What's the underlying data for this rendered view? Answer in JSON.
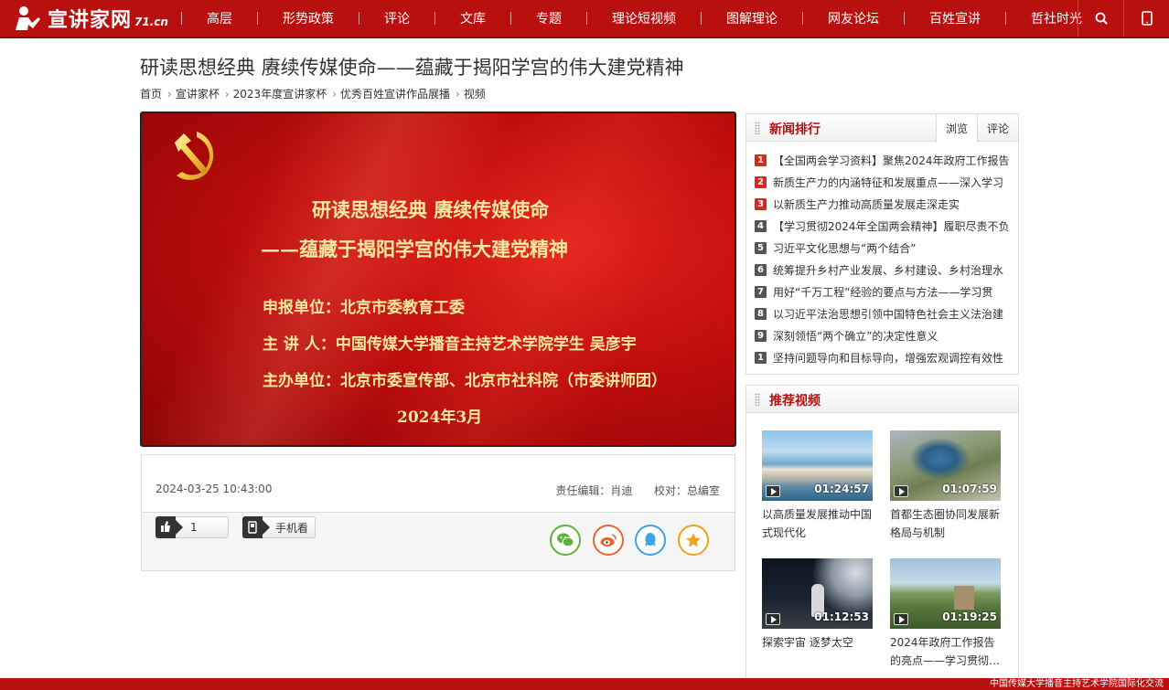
{
  "site": {
    "logo_text": "宣讲家网",
    "logo_sub": "71.cn"
  },
  "nav": {
    "items": [
      "高层",
      "形势政策",
      "评论",
      "文库",
      "专题",
      "理论短视频",
      "图解理论",
      "网友论坛",
      "百姓宣讲",
      "哲社时光"
    ],
    "icons": [
      "search-icon",
      "mobile-icon"
    ]
  },
  "article": {
    "title": "研读思想经典 赓续传媒使命——蕴藏于揭阳学宫的伟大建党精神",
    "breadcrumb": [
      "首页",
      "宣讲家杯",
      "2023年度宣讲家杯",
      "优秀百姓宣讲作品展播",
      "视频"
    ]
  },
  "video": {
    "title_line1": "研读思想经典 赓续传媒使命",
    "title_line2": "——蕴藏于揭阳学宫的伟大建党精神",
    "info": [
      "申报单位：北京市委教育工委",
      "主 讲  人：中国传媒大学播音主持艺术学院学生  吴彦宇",
      "主办单位：北京市委宣传部、北京市社科院（市委讲师团）"
    ],
    "date": "2024年3月"
  },
  "meta": {
    "datetime": "2024-03-25 10:43:00",
    "editor": "责任编辑：肖迪",
    "proof": "校对：总编室",
    "like_count": "1",
    "mobile_label": "手机看",
    "share_icons": [
      "wechat-icon",
      "weibo-icon",
      "qq-icon",
      "favorite-icon"
    ]
  },
  "ranking": {
    "title": "新闻排行",
    "tabs": [
      "浏览",
      "评论"
    ],
    "items": [
      {
        "num": "1",
        "text": "【全国两会学习资料】聚焦2024年政府工作报告"
      },
      {
        "num": "2",
        "text": "新质生产力的内涵特征和发展重点——深入学习"
      },
      {
        "num": "3",
        "text": "以新质生产力推动高质量发展走深走实"
      },
      {
        "num": "4",
        "text": "【学习贯彻2024年全国两会精神】履职尽责不负"
      },
      {
        "num": "5",
        "text": "习近平文化思想与“两个结合”"
      },
      {
        "num": "6",
        "text": "统筹提升乡村产业发展、乡村建设、乡村治理水"
      },
      {
        "num": "7",
        "text": "用好“千万工程”经验的要点与方法——学习贯"
      },
      {
        "num": "8",
        "text": "以习近平法治思想引领中国特色社会主义法治建"
      },
      {
        "num": "9",
        "text": "深刻领悟“两个确立”的决定性意义"
      },
      {
        "num": "1",
        "text": "坚持问题导向和目标导向，增强宏观调控有效性"
      }
    ]
  },
  "recommend": {
    "title": "推荐视频",
    "items": [
      {
        "duration": "01:24:57",
        "title": "以高质量发展推动中国式现代化"
      },
      {
        "duration": "01:07:59",
        "title": "首都生态圈协同发展新格局与机制"
      },
      {
        "duration": "01:12:53",
        "title": "探索宇宙 逐梦太空"
      },
      {
        "duration": "01:19:25",
        "title": "2024年政府工作报告的亮点——学习贯彻…"
      }
    ]
  },
  "footer": {
    "text": "中国传媒大学播音主持艺术学院国际化交流"
  },
  "colors": {
    "brand_red": "#b8100f",
    "hot_rank": "#d9281f",
    "normal_rank": "#555555",
    "wechat": "#5db33b",
    "weibo": "#e8672c",
    "qq": "#3aa5e0",
    "favorite": "#f0a21c"
  }
}
